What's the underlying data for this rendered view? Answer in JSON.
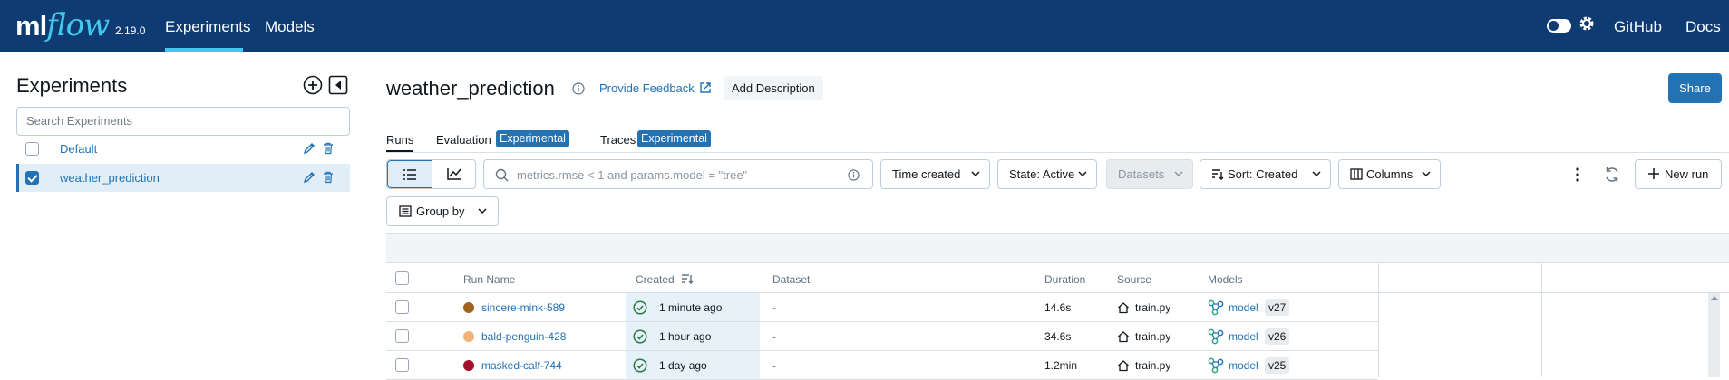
{
  "header": {
    "logo_ml": "ml",
    "logo_flow": "flow",
    "version": "2.19.0",
    "nav": [
      {
        "label": "Experiments"
      },
      {
        "label": "Models"
      }
    ],
    "github": "GitHub",
    "docs": "Docs",
    "accent": "#43c9ed",
    "bg": "#0e3b72"
  },
  "sidebar": {
    "title": "Experiments",
    "search_placeholder": "Search Experiments",
    "experiments": [
      {
        "name": "Default",
        "checked": false
      },
      {
        "name": "weather_prediction",
        "checked": true
      }
    ]
  },
  "main": {
    "title": "weather_prediction",
    "feedback": "Provide Feedback",
    "add_description": "Add Description",
    "share": "Share",
    "tabs": [
      {
        "label": "Runs"
      },
      {
        "label": "Evaluation",
        "badge": "Experimental"
      },
      {
        "label": "Traces",
        "badge": "Experimental"
      }
    ]
  },
  "toolbar": {
    "search_placeholder": "metrics.rmse < 1 and params.model = \"tree\"",
    "time_created": "Time created",
    "state": "State: Active",
    "datasets": "Datasets",
    "sort": "Sort: Created",
    "columns": "Columns",
    "new_run": "New run",
    "group_by": "Group by"
  },
  "table": {
    "columns": [
      "Run Name",
      "Created",
      "Dataset",
      "Duration",
      "Source",
      "Models"
    ],
    "rows": [
      {
        "name": "sincere-mink-589",
        "color": "#a0641a",
        "created": "1 minute ago",
        "dataset": "-",
        "duration": "14.6s",
        "source": "train.py",
        "model": "model",
        "version": "v27"
      },
      {
        "name": "bald-penguin-428",
        "color": "#f0b27a",
        "created": "1 hour ago",
        "dataset": "-",
        "duration": "34.6s",
        "source": "train.py",
        "model": "model",
        "version": "v26"
      },
      {
        "name": "masked-calf-744",
        "color": "#a0102a",
        "created": "1 day ago",
        "dataset": "-",
        "duration": "1.2min",
        "source": "train.py",
        "model": "model",
        "version": "v25"
      }
    ]
  }
}
